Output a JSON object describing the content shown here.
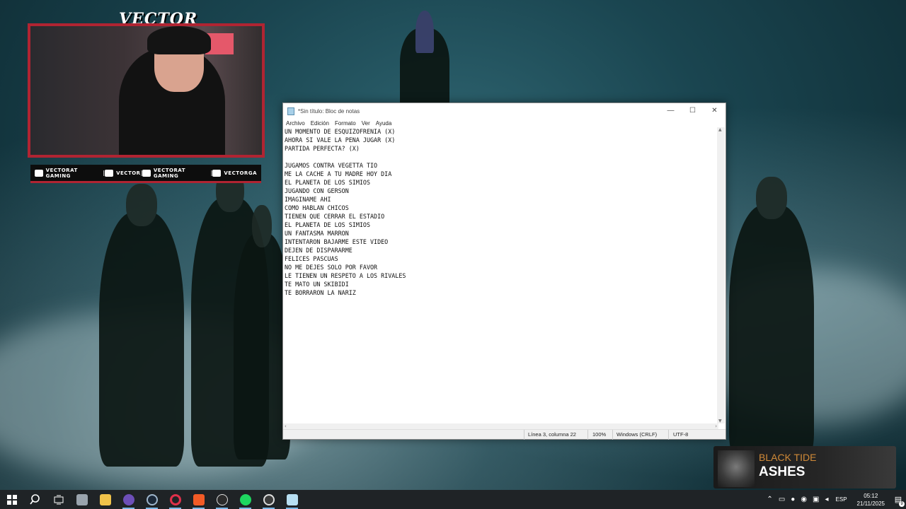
{
  "webcam": {
    "title": "VECTOR",
    "socials": [
      {
        "icon": "youtube-icon",
        "label": "VECTORAT GAMING"
      },
      {
        "icon": "twitch-icon",
        "label": "VECTOR"
      },
      {
        "icon": "twitter-icon",
        "label": "VECTORAT GAMING"
      },
      {
        "icon": "instagram-icon",
        "label": "VECTORGA"
      }
    ],
    "accent_color": "#b02432"
  },
  "notepad": {
    "title": "*Sin título: Bloc de notas",
    "menu": [
      "Archivo",
      "Edición",
      "Formato",
      "Ver",
      "Ayuda"
    ],
    "window_buttons": {
      "minimize": "—",
      "maximize": "☐",
      "close": "✕"
    },
    "content": "UN MOMENTO DE ESQUIZOFRENIA (X)\nAHORA SI VALE LA PENA JUGAR (X)\nPARTIDA PERFECTA? (X)\n\nJUGAMOS CONTRA VEGETTA TIO\nME LA CACHE A TU MADRE HOY DIA\nEL PLANETA DE LOS SIMIOS\nJUGANDO CON GERSON\nIMAGINAME AHI\nCOMO HABLAN CHICOS\nTIENEN QUE CERRAR EL ESTADIO\nEL PLANETA DE LOS SIMIOS\nUN FANTASMA MARRON\nINTENTARON BAJARME ESTE VIDEO\nDEJEN DE DISPARARME\nFELICES PASCUAS\nNO ME DEJES SOLO POR FAVOR\nLE TIENEN UN RESPETO A LOS RIVALES\nTE MATO UN SKIBIDI\nTE BORRARON LA NARIZ",
    "status": {
      "position": "Línea 3, columna 22",
      "zoom": "100%",
      "line_endings": "Windows (CRLF)",
      "encoding": "UTF-8"
    }
  },
  "music": {
    "artist": "BLACK TIDE",
    "song": "ASHES",
    "artist_color": "#d08a38"
  },
  "taskbar": {
    "apps": [
      "start-icon",
      "search-icon",
      "task-view-icon",
      "file-explorer-icon",
      "folder-icon",
      "discord-icon",
      "steam-icon",
      "opera-gx-icon",
      "brave-icon",
      "game-launcher-icon",
      "spotify-icon",
      "obs-icon",
      "notepad-icon"
    ],
    "tray": {
      "chevron": "⌃",
      "language": "ESP",
      "time": "05:12",
      "date": "21/11/2025",
      "notifications": "9"
    }
  }
}
